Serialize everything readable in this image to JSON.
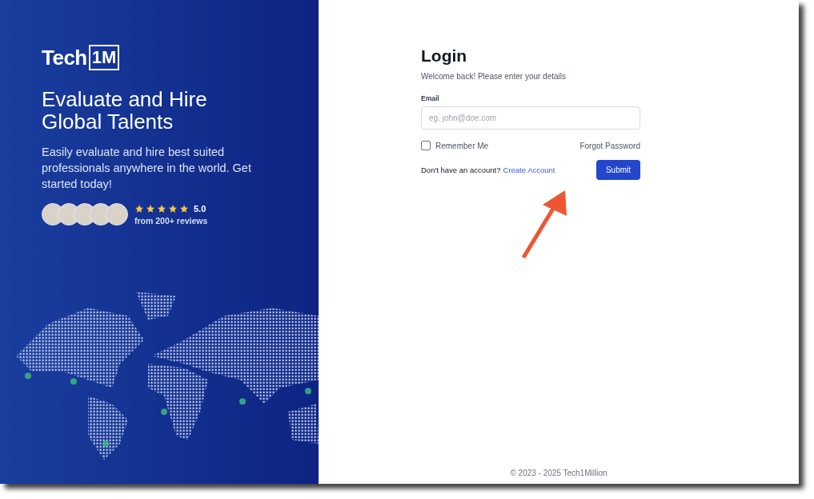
{
  "brand": {
    "name": "Tech",
    "mark": "1M"
  },
  "hero": {
    "title": "Evaluate and Hire Global Talents",
    "subtitle": "Easily evaluate and hire best suited professionals anywhere in the world. Get started today!",
    "rating": {
      "stars": 5,
      "score": "5.0",
      "reviews": "from 200+ reviews"
    }
  },
  "login": {
    "title": "Login",
    "subtitle": "Welcome back! Please enter your details",
    "email": {
      "label": "Email",
      "placeholder": "eg. john@doe.com"
    },
    "remember": {
      "label": "Remember Me",
      "checked": false
    },
    "forgot": "Forgot Password",
    "signup_prompt": "Don't have an account?",
    "signup_link": "Create Account",
    "submit": "Submit"
  },
  "footer": "© 2023 - 2025 Tech1Million"
}
